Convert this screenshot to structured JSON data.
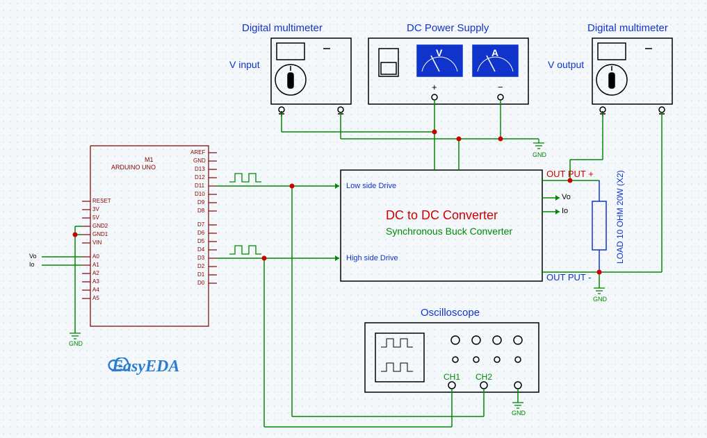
{
  "labels": {
    "dm_left_title": "Digital multimeter",
    "dm_right_title": "Digital multimeter",
    "psu_title": "DC Power Supply",
    "v_input": "V input",
    "v_output": "V output",
    "psu_V": "V",
    "psu_A": "A",
    "psu_plus": "+",
    "psu_minus": "−",
    "converter_title": "DC to DC Converter",
    "converter_sub": "Synchronous Buck Converter",
    "low_side": "Low side Drive",
    "high_side": "High side Drive",
    "out_plus": "OUT PUT +",
    "out_minus": "OUT PUT -",
    "vo": "Vo",
    "io": "Io",
    "load": "LOAD 10 OHM 20W (X2)",
    "osc_title": "Oscilloscope",
    "ch1": "CH1",
    "ch2": "CH2",
    "gnd": "GND",
    "m1": "M1",
    "arduino": "ARDUINO UNO",
    "aref": "AREF",
    "d_gnd": "GND",
    "d13": "D13",
    "d12": "D12",
    "d11": "D11",
    "d10": "D10",
    "d9": "D9",
    "d8": "D8",
    "d7": "D7",
    "d6": "D6",
    "d5": "D5",
    "d4": "D4",
    "d3": "D3",
    "d2": "D2",
    "d1": "D1",
    "d0": "D0",
    "reset": "RESET",
    "v3": "3V",
    "v5": "5V",
    "gnd2": "GND2",
    "gnd1": "GND1",
    "vin": "VIN",
    "a0": "A0",
    "a1": "A1",
    "a2": "A2",
    "a3": "A3",
    "a4": "A4",
    "a5": "A5",
    "logo": "EasyEDA"
  }
}
